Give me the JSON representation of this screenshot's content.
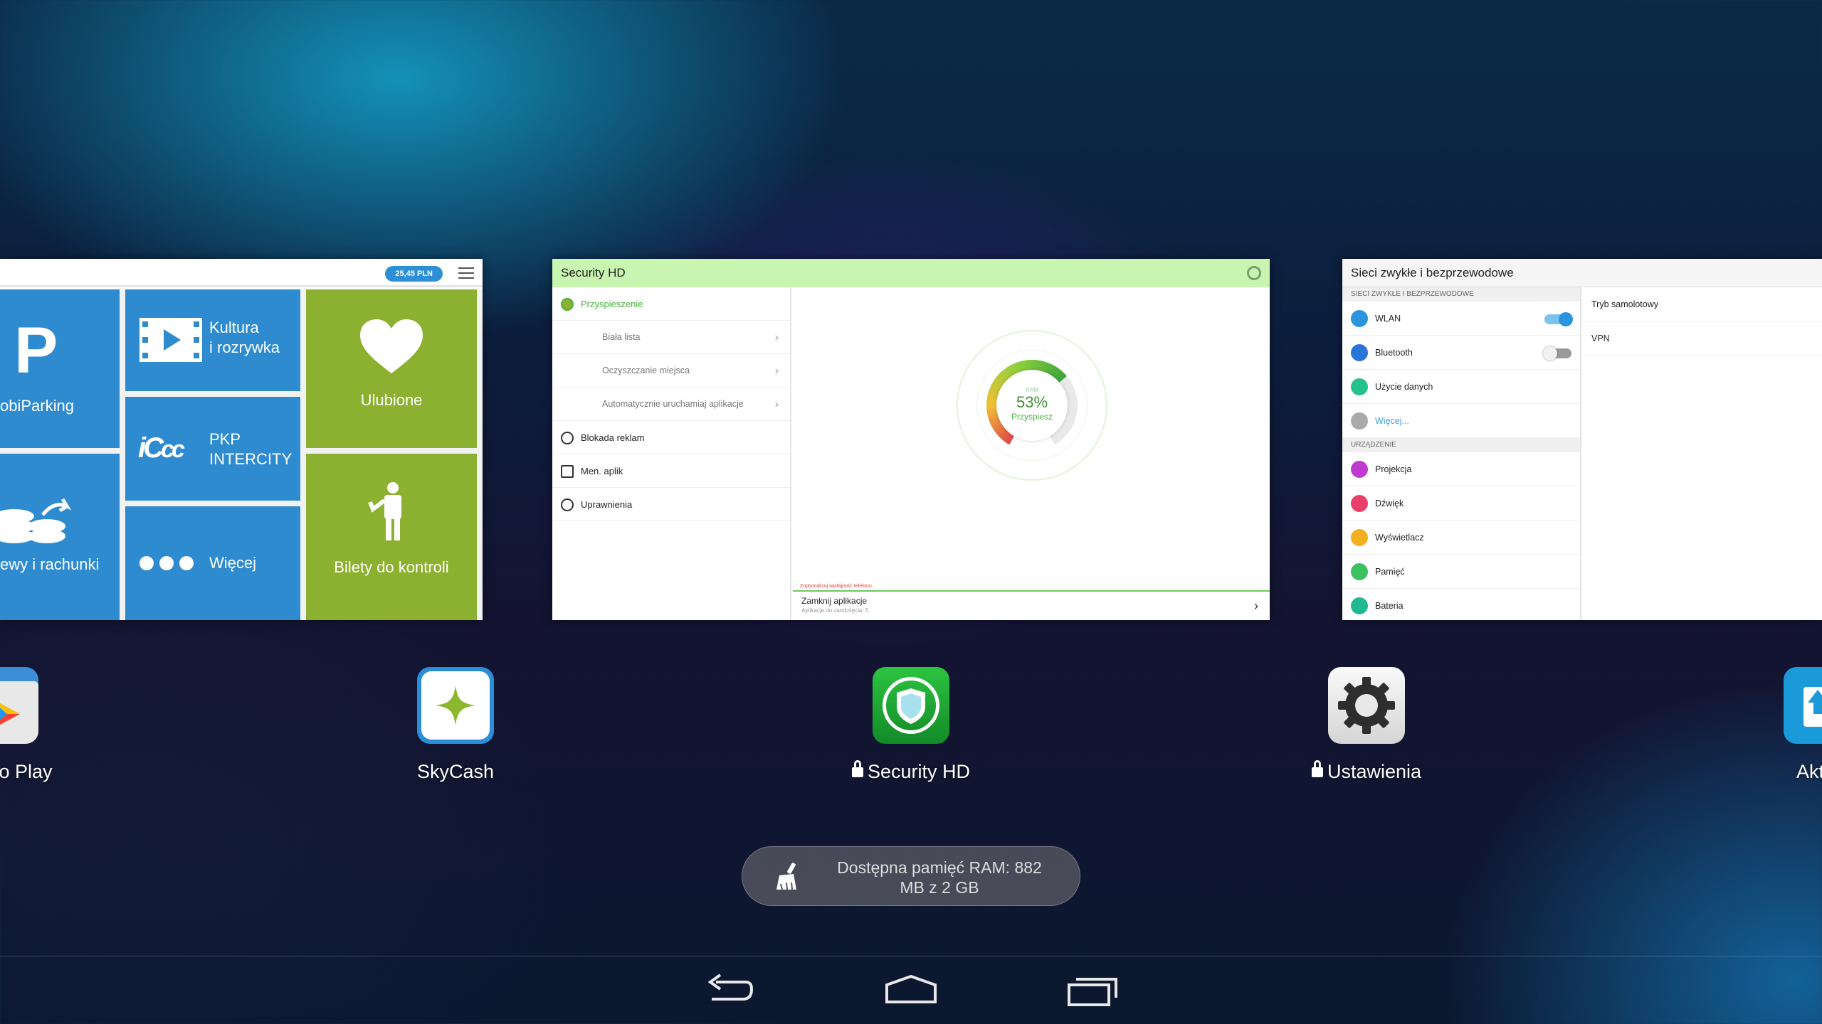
{
  "recents": {
    "mobile_parking": {
      "balance": "25,45 PLN",
      "tiles": {
        "parking": "obiParking",
        "kultura_line1": "Kultura",
        "kultura_line2": "i rozrywka",
        "ulubione": "Ulubione",
        "pkp_line1": "PKP",
        "pkp_line2": "INTERCITY",
        "oplaty": "ewy i rachunki",
        "wiecej": "Więcej",
        "bilety": "Bilety do kontroli"
      }
    },
    "security_hd": {
      "title": "Security HD",
      "menu": [
        {
          "label": "Przyspieszenie"
        },
        {
          "label": "Biała lista"
        },
        {
          "label": "Oczyszczanie miejsca"
        },
        {
          "label": "Automatycznie uruchamiaj aplikacje"
        },
        {
          "label": "Blokada reklam"
        },
        {
          "label": "Men. aplik"
        },
        {
          "label": "Uprawnienia"
        }
      ],
      "gauge": {
        "ram_label": "RAM",
        "percent": "53%",
        "button": "Przyspiesz"
      },
      "warning": "Zoptymalizuj wydajność telefonu.",
      "close_apps": "Zamknij aplikacje",
      "close_apps_sub": "Aplikacje do zamknięcia: 5"
    },
    "settings": {
      "title": "Sieci zwykłe i bezprzewodowe",
      "section1": "SIECI ZWYKŁE I BEZPRZEWODOWE",
      "items1": [
        {
          "label": "WLAN",
          "color": "#2a95de"
        },
        {
          "label": "Bluetooth",
          "color": "#2a75d8"
        },
        {
          "label": "Użycie danych",
          "color": "#26c08a"
        },
        {
          "label": "Więcej...",
          "color": "#aaaaaa"
        }
      ],
      "section2": "URZĄDZENIE",
      "items2": [
        {
          "label": "Projekcja",
          "color": "#c03ad0"
        },
        {
          "label": "Dźwięk",
          "color": "#e8406a"
        },
        {
          "label": "Wyświetlacz",
          "color": "#f2b020"
        },
        {
          "label": "Pamięć",
          "color": "#3cc060"
        },
        {
          "label": "Bateria",
          "color": "#20b890"
        }
      ],
      "right": [
        {
          "label": "Tryb samolotowy"
        },
        {
          "label": "VPN"
        }
      ]
    }
  },
  "apps": [
    {
      "label": "o Play",
      "icon": "play-store-icon",
      "locked": false
    },
    {
      "label": "SkyCash",
      "icon": "skycash-icon",
      "locked": false
    },
    {
      "label": "Security HD",
      "icon": "security-hd-icon",
      "locked": true
    },
    {
      "label": "Ustawienia",
      "icon": "settings-gear-icon",
      "locked": true
    },
    {
      "label": "Aktua",
      "icon": "update-icon",
      "locked": false
    }
  ],
  "ram": {
    "text_line1": "Dostępna pamięć RAM: 882",
    "text_line2": "MB  z 2 GB"
  },
  "nav": {
    "back": "back-icon",
    "home": "home-icon",
    "recents": "recents-icon"
  }
}
